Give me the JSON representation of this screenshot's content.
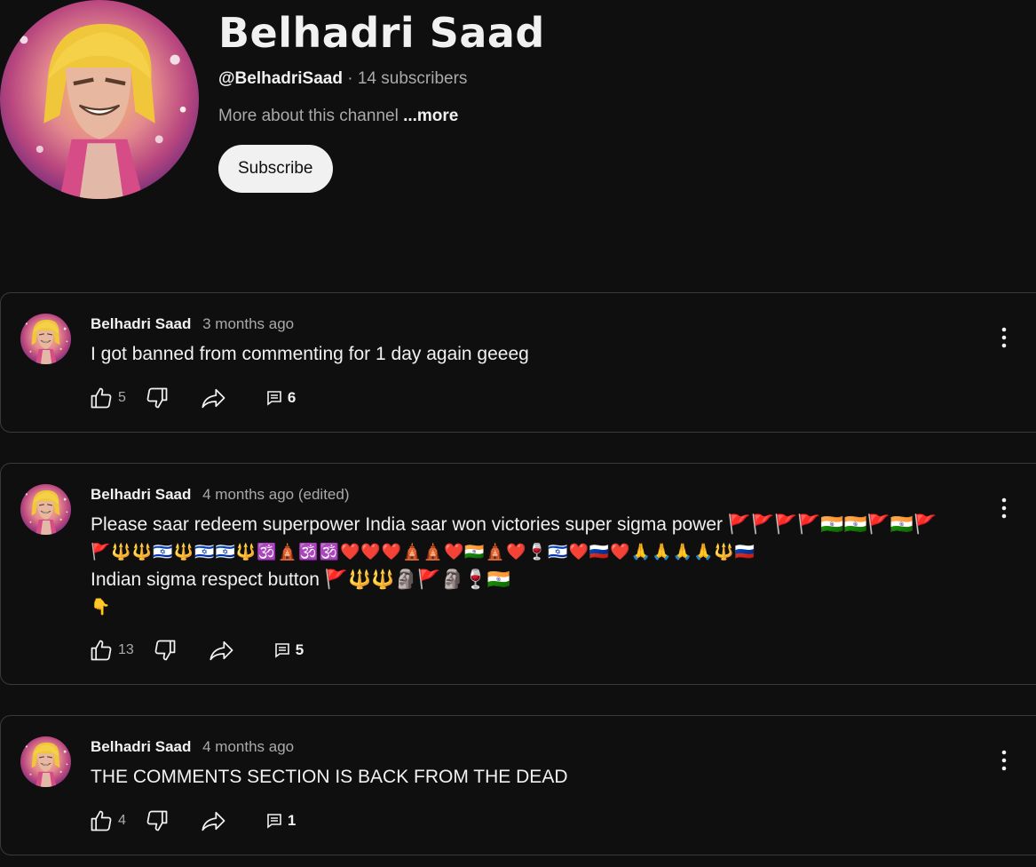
{
  "channel": {
    "name": "Belhadri Saad",
    "handle": "@BelhadriSaad",
    "separator": " · ",
    "subscribers": "14 subscribers",
    "about_text": "More about this channel",
    "more_label": "...more",
    "subscribe_label": "Subscribe"
  },
  "comments": [
    {
      "author": "Belhadri Saad",
      "time": "3 months ago",
      "text_lines": [
        "I got banned from commenting for 1 day again geeeg"
      ],
      "likes": "5",
      "replies": "6"
    },
    {
      "author": "Belhadri Saad",
      "time": "4 months ago (edited)",
      "text_lines": [
        "Please saar redeem superpower India saar won victories super sigma power 🚩🚩🚩🚩🇮🇳🇮🇳🚩🇮🇳🚩",
        "🚩🔱🔱🇮🇱🔱🇮🇱🇮🇱🔱🕉️🛕🕉️🕉️❤️❤️❤️🛕🛕❤️🇮🇳🛕❤️🍷🇮🇱❤️🇷🇺❤️🙏🙏🙏🙏🔱🇷🇺",
        "Indian sigma respect button 🚩🔱🔱🗿🚩🗿🍷🇮🇳",
        "👇"
      ],
      "likes": "13",
      "replies": "5"
    },
    {
      "author": "Belhadri Saad",
      "time": "4 months ago",
      "text_lines": [
        "THE COMMENTS SECTION IS BACK FROM THE DEAD"
      ],
      "likes": "4",
      "replies": "1"
    }
  ],
  "colors": {
    "background": "#0f0f0f",
    "text_primary": "#f1f1f1",
    "text_secondary": "#aaaaaa",
    "card_border": "#3a3a3a",
    "subscribe_bg": "#f1f1f1"
  },
  "icons": {
    "like": "thumbs-up-icon",
    "dislike": "thumbs-down-icon",
    "share": "share-arrow-icon",
    "replies": "comment-icon",
    "menu": "vertical-dots-icon"
  }
}
